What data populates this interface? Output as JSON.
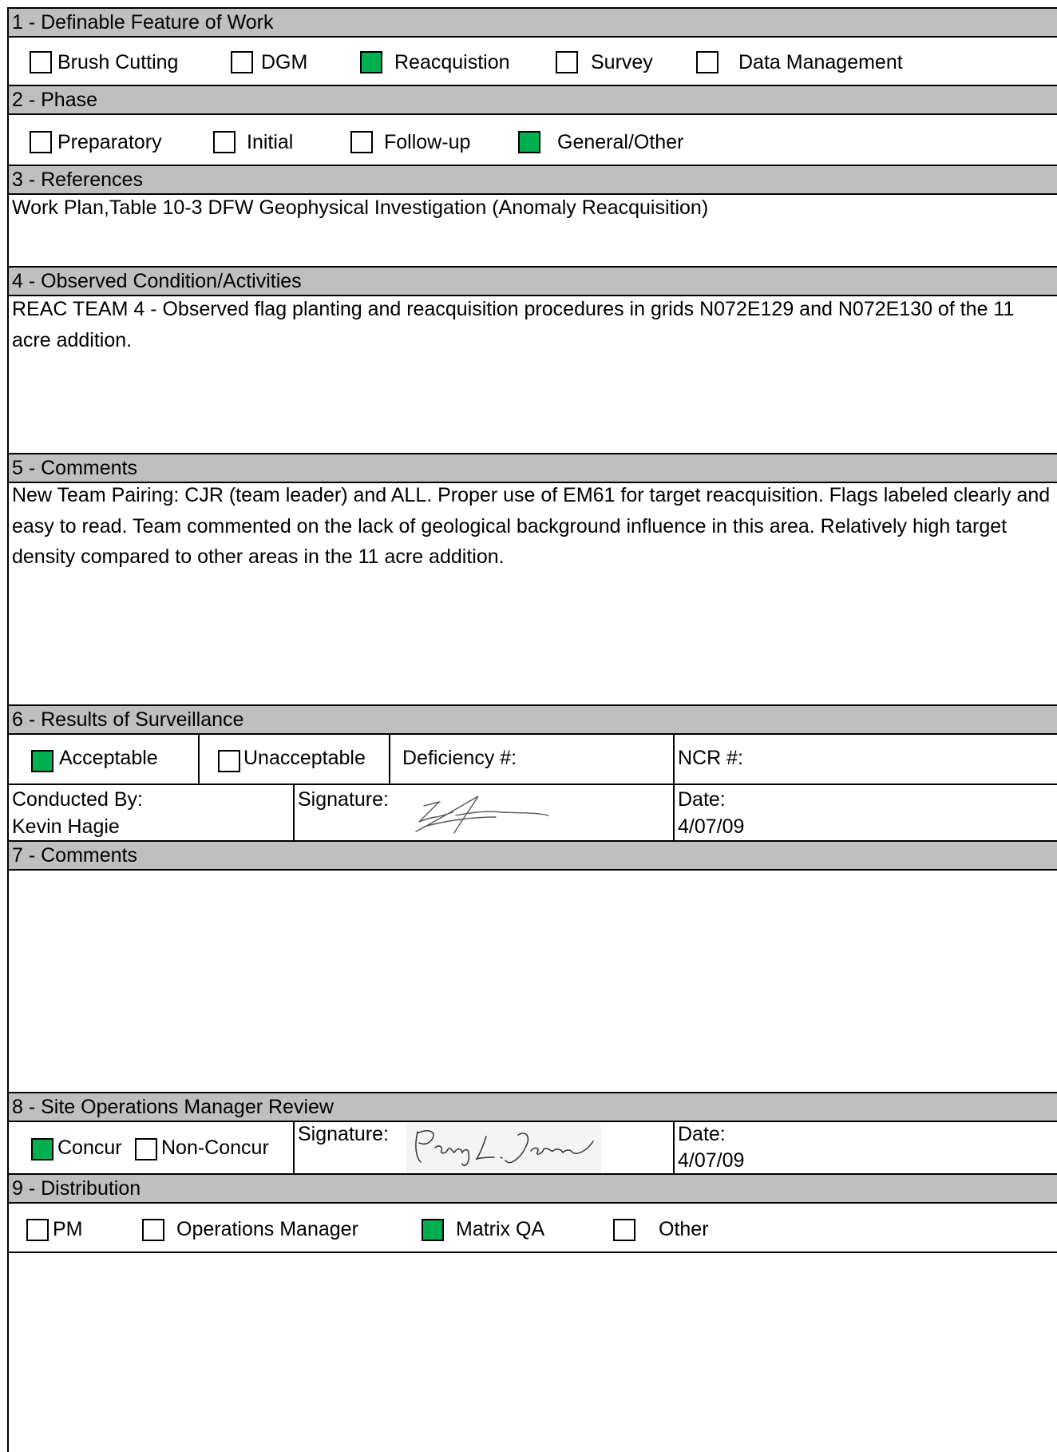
{
  "sections": {
    "s1": "1 - Definable Feature of Work",
    "s2": "2 - Phase",
    "s3": "3 - References",
    "s4": "4 - Observed Condition/Activities",
    "s5": "5 - Comments",
    "s6": "6 - Results of Surveillance",
    "s7": "7 - Comments",
    "s8": "8 - Site Operations Manager Review",
    "s9": "9 - Distribution"
  },
  "feature_options": [
    {
      "label": "Brush Cutting",
      "checked": false
    },
    {
      "label": "DGM",
      "checked": false
    },
    {
      "label": "Reacquistion",
      "checked": true
    },
    {
      "label": "Survey",
      "checked": false
    },
    {
      "label": "Data Management",
      "checked": false
    }
  ],
  "phase_options": [
    {
      "label": "Preparatory",
      "checked": false
    },
    {
      "label": "Initial",
      "checked": false
    },
    {
      "label": "Follow-up",
      "checked": false
    },
    {
      "label": "General/Other",
      "checked": true
    }
  ],
  "references": "Work Plan,Table 10-3 DFW Geophysical Investigation (Anomaly Reacquisition)",
  "observed": "REAC TEAM 4 - Observed flag planting and reacquisition procedures in grids N072E129 and N072E130 of the 11 acre addition.",
  "comments": "New Team Pairing:  CJR (team leader) and ALL.  Proper use of EM61 for target reacquisition.  Flags labeled clearly and easy to read.  Team commented on the lack of geological background influence in this area.  Relatively high target density compared to other areas in the 11 acre addition.",
  "results": {
    "acceptable": {
      "label": "Acceptable",
      "checked": true
    },
    "unacceptable": {
      "label": "Unacceptable",
      "checked": false
    },
    "deficiency_label": "Deficiency #:",
    "ncr_label": "NCR #:",
    "conducted_by_label": "Conducted By:",
    "conducted_by": "Kevin Hagie",
    "signature_label": "Signature:",
    "date_label": "Date:",
    "date": "4/07/09"
  },
  "comments7": "",
  "review": {
    "concur": {
      "label": "Concur",
      "checked": true
    },
    "non_concur": {
      "label": "Non-Concur",
      "checked": false
    },
    "signature_label": "Signature:",
    "signature_name": "Penny L. Johnson",
    "date_label": "Date:",
    "date": "4/07/09"
  },
  "distribution": [
    {
      "label": "PM",
      "checked": false
    },
    {
      "label": "Operations Manager",
      "checked": false
    },
    {
      "label": "Matrix QA",
      "checked": true
    },
    {
      "label": "Other",
      "checked": false
    }
  ],
  "colors": {
    "checked": "#00b050",
    "header": "#bfbfbf"
  }
}
